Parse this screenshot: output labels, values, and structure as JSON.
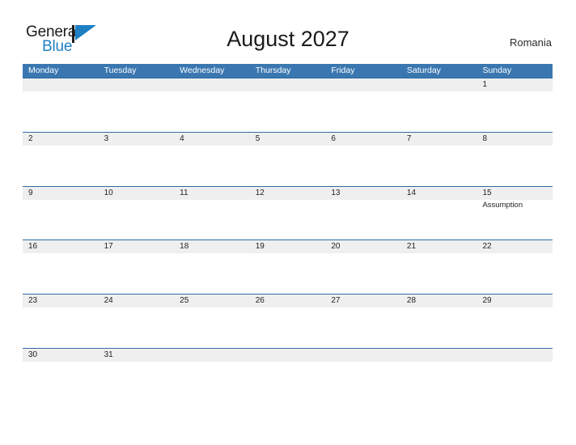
{
  "branding": {
    "logo_text_primary": "General",
    "logo_text_secondary": "Blue",
    "logo_icon": "flag-triangle-icon",
    "primary_color": "#1f7fc4",
    "header_blue": "#3a77b0",
    "row_divider_color": "#2e6da4",
    "day_band_color": "#efefef"
  },
  "header": {
    "title": "August 2027",
    "country": "Romania"
  },
  "calendar": {
    "weekdays": [
      "Monday",
      "Tuesday",
      "Wednesday",
      "Thursday",
      "Friday",
      "Saturday",
      "Sunday"
    ],
    "weeks": [
      [
        {
          "day": "",
          "event": ""
        },
        {
          "day": "",
          "event": ""
        },
        {
          "day": "",
          "event": ""
        },
        {
          "day": "",
          "event": ""
        },
        {
          "day": "",
          "event": ""
        },
        {
          "day": "",
          "event": ""
        },
        {
          "day": "1",
          "event": ""
        }
      ],
      [
        {
          "day": "2",
          "event": ""
        },
        {
          "day": "3",
          "event": ""
        },
        {
          "day": "4",
          "event": ""
        },
        {
          "day": "5",
          "event": ""
        },
        {
          "day": "6",
          "event": ""
        },
        {
          "day": "7",
          "event": ""
        },
        {
          "day": "8",
          "event": ""
        }
      ],
      [
        {
          "day": "9",
          "event": ""
        },
        {
          "day": "10",
          "event": ""
        },
        {
          "day": "11",
          "event": ""
        },
        {
          "day": "12",
          "event": ""
        },
        {
          "day": "13",
          "event": ""
        },
        {
          "day": "14",
          "event": ""
        },
        {
          "day": "15",
          "event": "Assumption"
        }
      ],
      [
        {
          "day": "16",
          "event": ""
        },
        {
          "day": "17",
          "event": ""
        },
        {
          "day": "18",
          "event": ""
        },
        {
          "day": "19",
          "event": ""
        },
        {
          "day": "20",
          "event": ""
        },
        {
          "day": "21",
          "event": ""
        },
        {
          "day": "22",
          "event": ""
        }
      ],
      [
        {
          "day": "23",
          "event": ""
        },
        {
          "day": "24",
          "event": ""
        },
        {
          "day": "25",
          "event": ""
        },
        {
          "day": "26",
          "event": ""
        },
        {
          "day": "27",
          "event": ""
        },
        {
          "day": "28",
          "event": ""
        },
        {
          "day": "29",
          "event": ""
        }
      ],
      [
        {
          "day": "30",
          "event": ""
        },
        {
          "day": "31",
          "event": ""
        },
        {
          "day": "",
          "event": ""
        },
        {
          "day": "",
          "event": ""
        },
        {
          "day": "",
          "event": ""
        },
        {
          "day": "",
          "event": ""
        },
        {
          "day": "",
          "event": ""
        }
      ]
    ]
  }
}
